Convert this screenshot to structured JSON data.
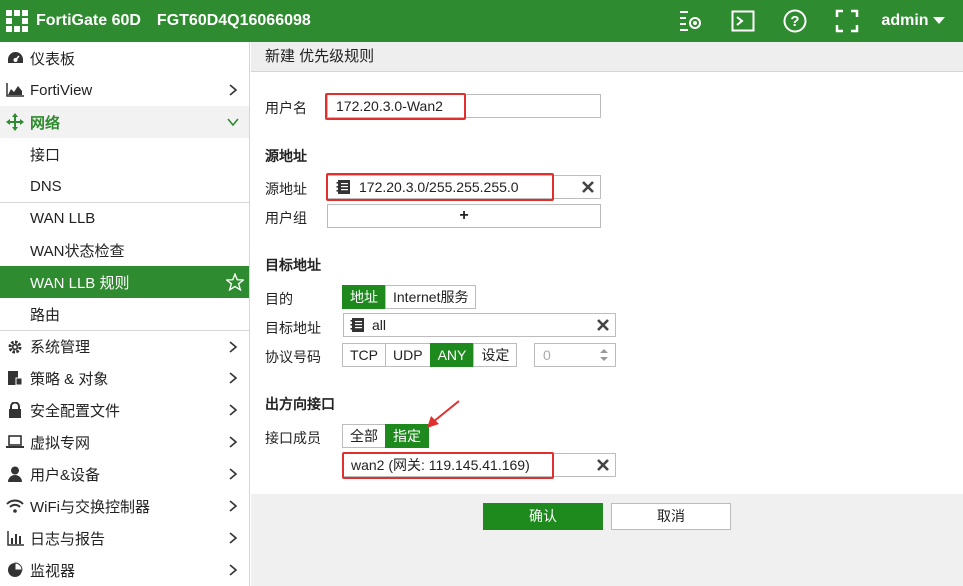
{
  "topbar": {
    "product": "FortiGate 60D",
    "serial": "FGT60D4Q16066098",
    "user": "admin"
  },
  "sidebar": {
    "items": [
      {
        "label": "仪表板"
      },
      {
        "label": "FortiView"
      },
      {
        "label": "网络"
      },
      {
        "label": "接口"
      },
      {
        "label": "DNS"
      },
      {
        "label": "WAN LLB"
      },
      {
        "label": "WAN状态检查"
      },
      {
        "label": "WAN LLB 规则"
      },
      {
        "label": "路由"
      },
      {
        "label": "系统管理"
      },
      {
        "label": "策略 & 对象"
      },
      {
        "label": "安全配置文件"
      },
      {
        "label": "虚拟专网"
      },
      {
        "label": "用户&设备"
      },
      {
        "label": "WiFi与交换控制器"
      },
      {
        "label": "日志与报告"
      },
      {
        "label": "监视器"
      }
    ]
  },
  "form": {
    "header": "新建 优先级规则",
    "name_label": "用户名",
    "name_value": "172.20.3.0-Wan2",
    "source_section": "源地址",
    "source_addr_label": "源地址",
    "source_addr_value": "172.20.3.0/255.255.255.0",
    "user_group_label": "用户组",
    "user_group_add": "+",
    "dest_section": "目标地址",
    "dest_label": "目的",
    "dest_opts": [
      "地址",
      "Internet服务"
    ],
    "dest_addr_label": "目标地址",
    "dest_addr_value": "all",
    "proto_label": "协议号码",
    "proto_opts": [
      "TCP",
      "UDP",
      "ANY",
      "设定"
    ],
    "proto_number": "0",
    "out_section": "出方向接口",
    "member_label": "接口成员",
    "member_opts": [
      "全部",
      "指定"
    ],
    "member_value": "wan2 (网关: 119.145.41.169)",
    "ok": "确认",
    "cancel": "取消"
  },
  "colors": {
    "accent": "#2f8b2f",
    "highlight": "#e0302e"
  }
}
